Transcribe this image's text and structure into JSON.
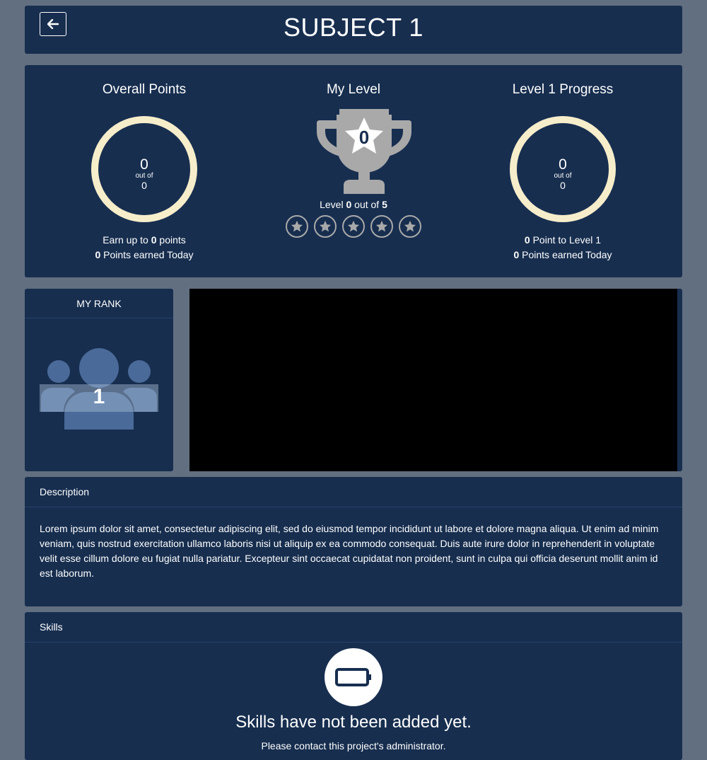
{
  "header": {
    "title": "SUBJECT 1",
    "back_icon": "arrow-left-icon"
  },
  "stats": {
    "overall": {
      "title": "Overall Points",
      "value": "0",
      "out_of_label": "out of",
      "total": "0",
      "earn_prefix": "Earn up to",
      "earn_value": "0",
      "earn_suffix": "points",
      "today_value": "0",
      "today_label": "Points earned Today",
      "progress_fraction": 0
    },
    "level": {
      "title": "My Level",
      "trophy_value": "0",
      "level_prefix": "Level",
      "level_value": "0",
      "level_mid": "out of",
      "level_total": "5",
      "stars_total": 5,
      "stars_earned": 0
    },
    "progress": {
      "title": "Level 1 Progress",
      "value": "0",
      "out_of_label": "out of",
      "total": "0",
      "next_value": "0",
      "next_label": "Point to Level 1",
      "today_value": "0",
      "today_label": "Points earned Today",
      "progress_fraction": 0
    }
  },
  "rank": {
    "title": "MY RANK",
    "value": "1",
    "icon": "users-icon"
  },
  "description": {
    "title": "Description",
    "text": "Lorem ipsum dolor sit amet, consectetur adipiscing elit, sed do eiusmod tempor incididunt ut labore et dolore magna aliqua. Ut enim ad minim veniam, quis nostrud exercitation ullamco laboris nisi ut aliquip ex ea commodo consequat. Duis aute irure dolor in reprehenderit in voluptate velit esse cillum dolore eu fugiat nulla pariatur. Excepteur sint occaecat cupidatat non proident, sunt in culpa qui officia deserunt mollit anim id est laborum."
  },
  "skills": {
    "title": "Skills",
    "empty_title": "Skills have not been added yet.",
    "empty_subtitle": "Please contact this project's administrator.",
    "empty_icon": "battery-empty-icon"
  },
  "colors": {
    "background": "#626f80",
    "panel": "#172e4f",
    "ring": "#f6edcb",
    "trophy": "#a9a9a9",
    "rank_icon": "#4a6a99"
  }
}
